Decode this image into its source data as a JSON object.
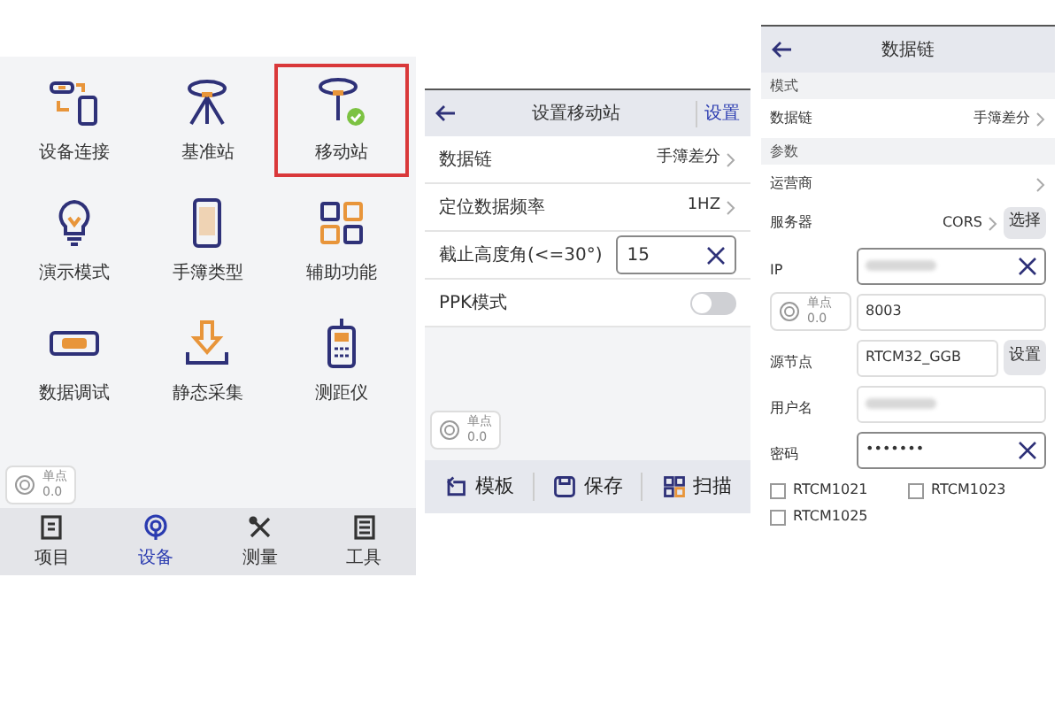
{
  "device_menu": {
    "items": [
      {
        "label": "设备连接",
        "selected": false
      },
      {
        "label": "基准站",
        "selected": false
      },
      {
        "label": "移动站",
        "selected": true
      },
      {
        "label": "演示模式",
        "selected": false
      },
      {
        "label": "手簿类型",
        "selected": false
      },
      {
        "label": "辅助功能",
        "selected": false
      },
      {
        "label": "数据调试",
        "selected": false
      },
      {
        "label": "静态采集",
        "selected": false
      },
      {
        "label": "测距仪",
        "selected": false
      }
    ],
    "position_badge": {
      "mode": "单点",
      "value": "0.0"
    },
    "tabs": [
      {
        "label": "项目",
        "selected": false
      },
      {
        "label": "设备",
        "selected": true
      },
      {
        "label": "测量",
        "selected": false
      },
      {
        "label": "工具",
        "selected": false
      }
    ]
  },
  "rover_settings": {
    "title": "设置移动站",
    "action": "设置",
    "rows": [
      {
        "kind": "select",
        "label": "数据链",
        "value": "手簿差分"
      },
      {
        "kind": "select",
        "label": "定位数据频率",
        "value": "1HZ"
      },
      {
        "kind": "input",
        "label": "截止高度角(<=30°)",
        "value": "15"
      },
      {
        "kind": "toggle",
        "label": "PPK模式",
        "on": false
      }
    ],
    "position_badge": {
      "mode": "单点",
      "value": "0.0"
    },
    "buttons": [
      {
        "label": "模板"
      },
      {
        "label": "保存"
      },
      {
        "label": "扫描"
      }
    ]
  },
  "data_link": {
    "title": "数据链",
    "rows": [
      {
        "kind": "section",
        "label": "模式"
      },
      {
        "kind": "select",
        "label": "数据链",
        "value": "手簿差分"
      },
      {
        "kind": "section",
        "label": "参数"
      },
      {
        "kind": "select",
        "label": "运营商"
      },
      {
        "kind": "select",
        "label": "服务器",
        "value": "CORS",
        "button": "选择"
      },
      {
        "kind": "input",
        "label": "IP",
        "blurred": true,
        "clearable": true
      },
      {
        "kind": "input",
        "value": "8003",
        "covered_label": true
      },
      {
        "kind": "input",
        "label": "源节点",
        "value": "RTCM32_GGB",
        "button": "设置"
      },
      {
        "kind": "input",
        "label": "用户名",
        "blurred": true
      },
      {
        "kind": "input",
        "label": "密码",
        "value": "•••••••",
        "clearable": true
      }
    ],
    "position_badge": {
      "mode": "单点",
      "value": "0.0"
    },
    "checkboxes": [
      {
        "label": "RTCM1021",
        "checked": false
      },
      {
        "label": "RTCM1023",
        "checked": false
      },
      {
        "label": "RTCM1025",
        "checked": false
      }
    ]
  }
}
